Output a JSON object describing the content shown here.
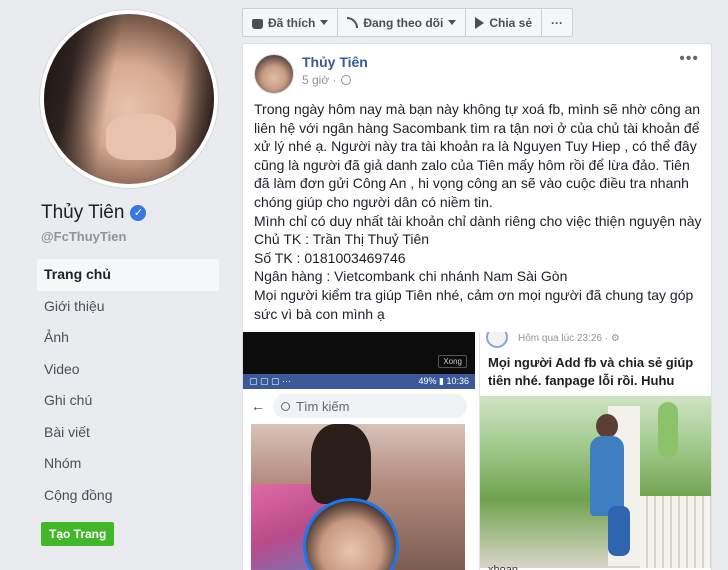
{
  "left": {
    "page_name": "Thủy Tiên",
    "handle": "@FcThuyTien",
    "nav": [
      "Trang chủ",
      "Giới thiệu",
      "Ảnh",
      "Video",
      "Ghi chú",
      "Bài viết",
      "Nhóm",
      "Cộng đồng"
    ],
    "create_page_label": "Tạo Trang"
  },
  "actions": {
    "liked": "Đã thích",
    "following": "Đang theo dõi",
    "share": "Chia sẻ",
    "more": "···"
  },
  "post": {
    "author": "Thủy Tiên",
    "time": "5 giờ ·",
    "more": "•••",
    "lines": [
      "Trong ngày hôm nay mà bạn này không tự xoá fb, mình sẽ nhờ công an liên hệ với ngân hàng Sacombank tìm ra tận nơi ở của chủ tài khoản để xử lý nhé ạ. Người này tra tài khoản ra là Nguyen Tuy Hiep , có thể đây cũng là người đã giả danh zalo của Tiên mấy hôm rồi để lừa đảo. Tiên đã làm đơn gửi Công An , hi vọng công an sẽ vào cuộc điều tra nhanh chóng giúp cho người dân có niềm tin.",
      "Mình chỉ có duy nhất tài khoản chỉ dành riêng cho việc thiện nguyện này",
      "Chủ TK : Trần Thị Thuỷ Tiên",
      "Số TK : 0181003469746",
      "Ngân hàng : Vietcombank chi nhánh Nam Sài Gòn",
      "Mọi người kiểm tra giúp Tiên nhé, cảm ơn mọi người đã chung tay góp sức vì bà con mình ạ"
    ]
  },
  "image_left": {
    "done_button": "Xong",
    "status_time": "49% ▮ 10:36",
    "search_placeholder": "Tìm kiếm"
  },
  "image_right": {
    "meta": "Hôm qua lúc 23:26 · ⚙",
    "caption": "Mọi người Add fb và chia sẻ giúp tiên nhé. fanpage lỗi rồi. Huhu",
    "footer_peek": "xhoan"
  },
  "colors": {
    "link_blue": "#385898",
    "green_button": "#42b72a",
    "verified_blue": "#3578e5"
  }
}
